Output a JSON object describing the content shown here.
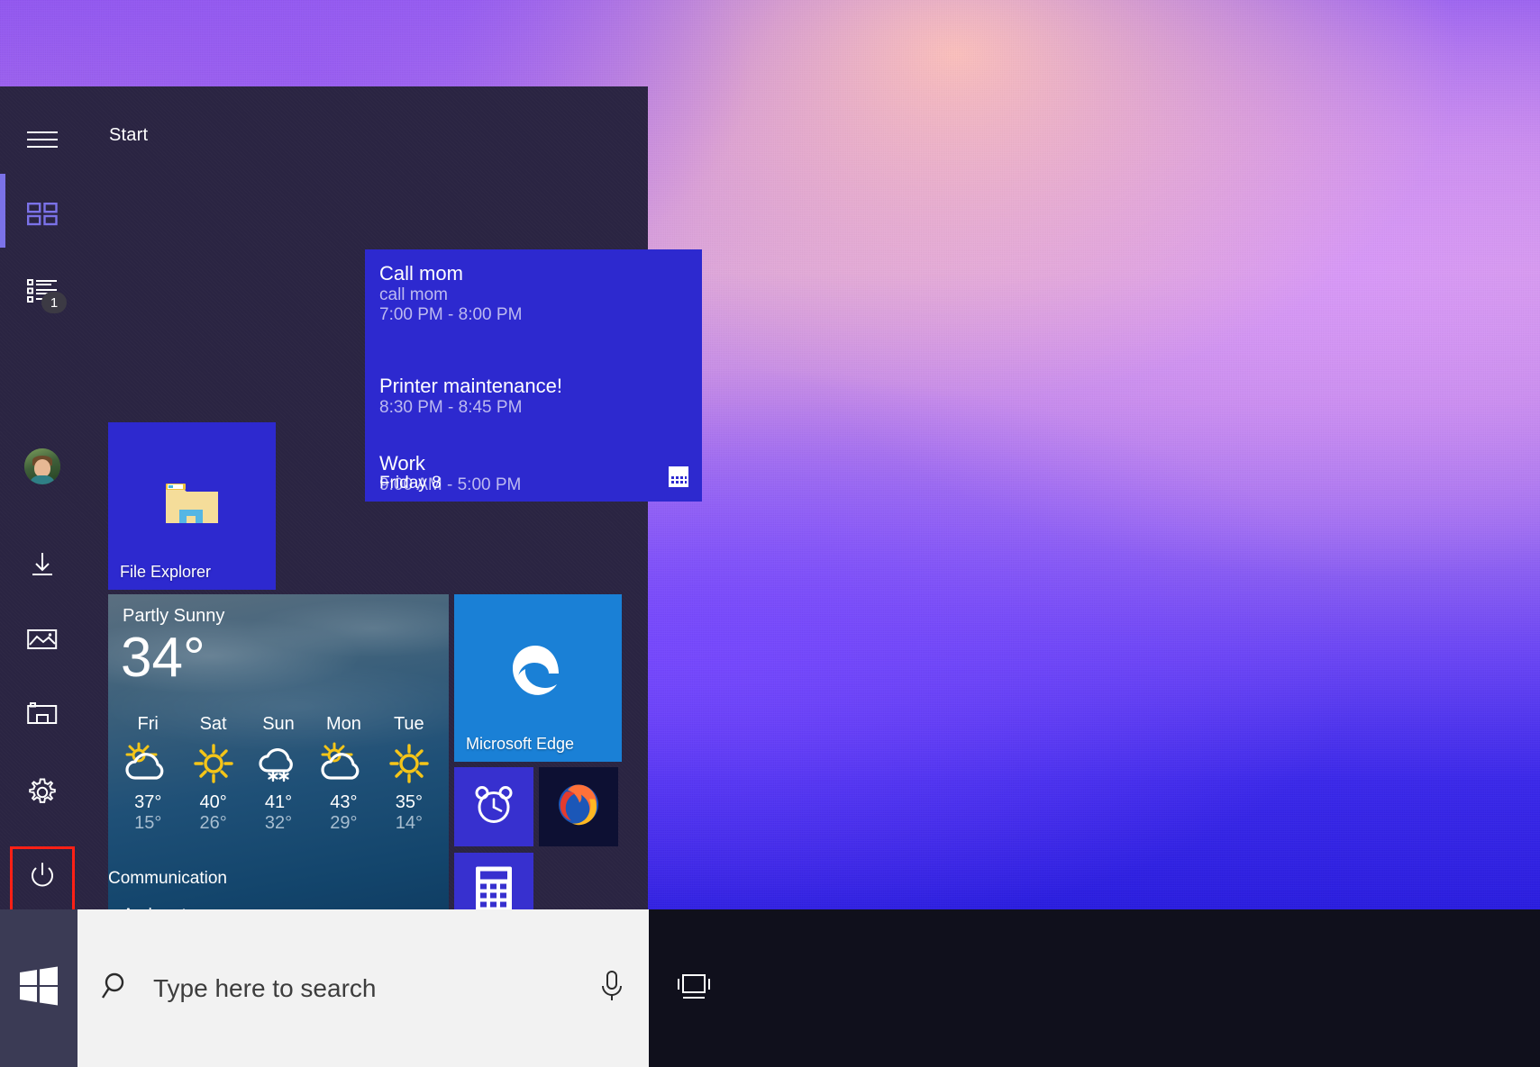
{
  "os": {
    "accent_color": "#2d29cf",
    "menu_background": "#2a2442",
    "highlight_color": "#ff2015"
  },
  "start_menu": {
    "header_label": "Start",
    "group_label": "Communication",
    "rail": [
      {
        "name": "hamburger",
        "icon": "hamburger-icon",
        "label": "Expand"
      },
      {
        "name": "grid",
        "icon": "grid-icon",
        "label": "Start"
      },
      {
        "name": "list",
        "icon": "list-icon",
        "label": "Notifications",
        "badge": "1"
      },
      {
        "name": "user",
        "icon": "avatar-icon",
        "label": "User account"
      },
      {
        "name": "downloads",
        "icon": "download-icon",
        "label": "Downloads"
      },
      {
        "name": "pictures",
        "icon": "picture-icon",
        "label": "Pictures"
      },
      {
        "name": "documents",
        "icon": "documents-icon",
        "label": "Documents"
      },
      {
        "name": "settings",
        "icon": "gear-icon",
        "label": "Settings",
        "highlighted": true
      },
      {
        "name": "power",
        "icon": "power-icon",
        "label": "Power"
      }
    ],
    "tiles": {
      "calendar": {
        "footer": "Friday 8",
        "icon": "calendar-icon",
        "events": [
          {
            "title": "Call mom",
            "subtitle": "call mom",
            "time": "7:00 PM - 8:00 PM"
          },
          {
            "title": "Printer maintenance!",
            "subtitle": "",
            "time": "8:30 PM - 8:45 PM"
          },
          {
            "title": "Work",
            "subtitle": "",
            "time": "9:00 AM - 5:00 PM"
          }
        ]
      },
      "file_explorer": {
        "label": "File Explorer",
        "icon": "folder-icon"
      },
      "weather": {
        "condition": "Partly Sunny",
        "current_temp": "34°",
        "city": "Amherst",
        "forecast": [
          {
            "day": "Fri",
            "icon": "partly-sunny-icon",
            "high": "37°",
            "low": "15°"
          },
          {
            "day": "Sat",
            "icon": "sunny-icon",
            "high": "40°",
            "low": "26°"
          },
          {
            "day": "Sun",
            "icon": "snow-icon",
            "high": "41°",
            "low": "32°"
          },
          {
            "day": "Mon",
            "icon": "cloudy-icon",
            "high": "43°",
            "low": "29°"
          },
          {
            "day": "Tue",
            "icon": "sunny-icon",
            "high": "35°",
            "low": "14°"
          }
        ]
      },
      "edge": {
        "label": "Microsoft Edge",
        "icon": "edge-icon"
      },
      "alarm": {
        "label": "Alarms & Clock",
        "icon": "alarm-clock-icon"
      },
      "firefox": {
        "label": "Firefox",
        "icon": "firefox-icon"
      },
      "calculator": {
        "label": "Calculator",
        "icon": "calculator-icon"
      }
    }
  },
  "taskbar": {
    "start_button": {
      "icon": "windows-logo-icon",
      "label": "Start"
    },
    "search": {
      "placeholder": "Type here to search",
      "value": "",
      "search_icon": "search-icon",
      "mic_icon": "microphone-icon"
    },
    "task_view": {
      "icon": "task-view-icon",
      "label": "Task View"
    }
  }
}
